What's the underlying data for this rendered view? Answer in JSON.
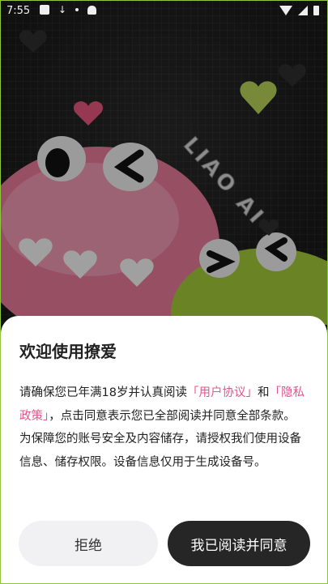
{
  "status_bar": {
    "time": "7:55"
  },
  "hero": {
    "logo_text": "LIAO AI"
  },
  "dialog": {
    "title": "欢迎使用撩爱",
    "text_1": "请确保您已年满18岁并认真阅读",
    "link_user_agreement": "「用户协议」",
    "text_2": "和",
    "link_privacy_policy": "「隐私政策」",
    "text_3": "，点击同意表示您已全部阅读并同意全部条款。为保障您的账号安全及内容储存，请授权我们使用设备信息、储存权限。设备信息仅用于生成设备号。",
    "decline_label": "拒绝",
    "agree_label": "我已阅读并同意"
  },
  "colors": {
    "link": "#e8548a",
    "agree_button": "#262626",
    "decline_button": "#f1f1f3",
    "frame_border": "#8ec63f"
  }
}
